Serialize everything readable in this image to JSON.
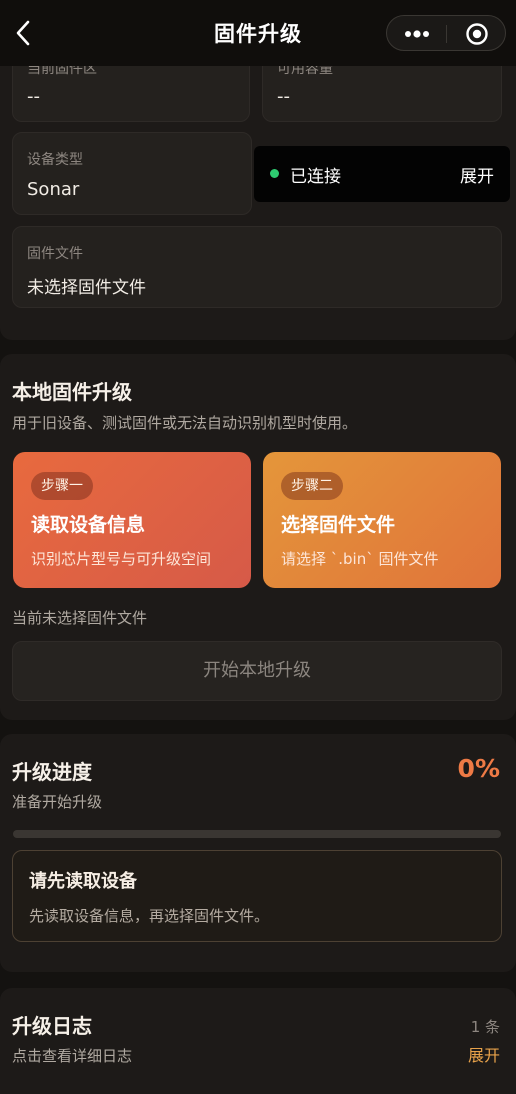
{
  "navbar": {
    "title": "固件升级",
    "back_icon": "chevron-left-icon",
    "more_icon": "more-dots-icon",
    "close_icon": "record-circle-icon"
  },
  "device_info": {
    "current_firmware": {
      "label": "当前固件区",
      "value": "--"
    },
    "available_capacity": {
      "label": "可用容量",
      "value": "--"
    },
    "device_type": {
      "label": "设备类型",
      "value": "Sonar"
    },
    "firmware_file": {
      "label": "固件文件",
      "value": "未选择固件文件"
    }
  },
  "connection": {
    "status": "已连接",
    "expand_label": "展开",
    "status_color": "#2ecc71"
  },
  "local_upgrade": {
    "title": "本地固件升级",
    "subtitle": "用于旧设备、测试固件或无法自动识别机型时使用。",
    "steps": [
      {
        "tag": "步骤一",
        "title": "读取设备信息",
        "desc": "识别芯片型号与可升级空间"
      },
      {
        "tag": "步骤二",
        "title": "选择固件文件",
        "desc": "请选择 `.bin` 固件文件"
      }
    ],
    "file_status": "当前未选择固件文件",
    "start_button": "开始本地升级"
  },
  "progress": {
    "title": "升级进度",
    "subtitle": "准备开始升级",
    "percent_text": "0%",
    "percent_value": 0,
    "accent": "#ee7a45",
    "notice": {
      "title": "请先读取设备",
      "desc": "先读取设备信息，再选择固件文件。"
    }
  },
  "log": {
    "title": "升级日志",
    "subtitle": "点击查看详细日志",
    "count": "1 条",
    "expand_label": "展开",
    "expand_color": "#e8a24a"
  }
}
